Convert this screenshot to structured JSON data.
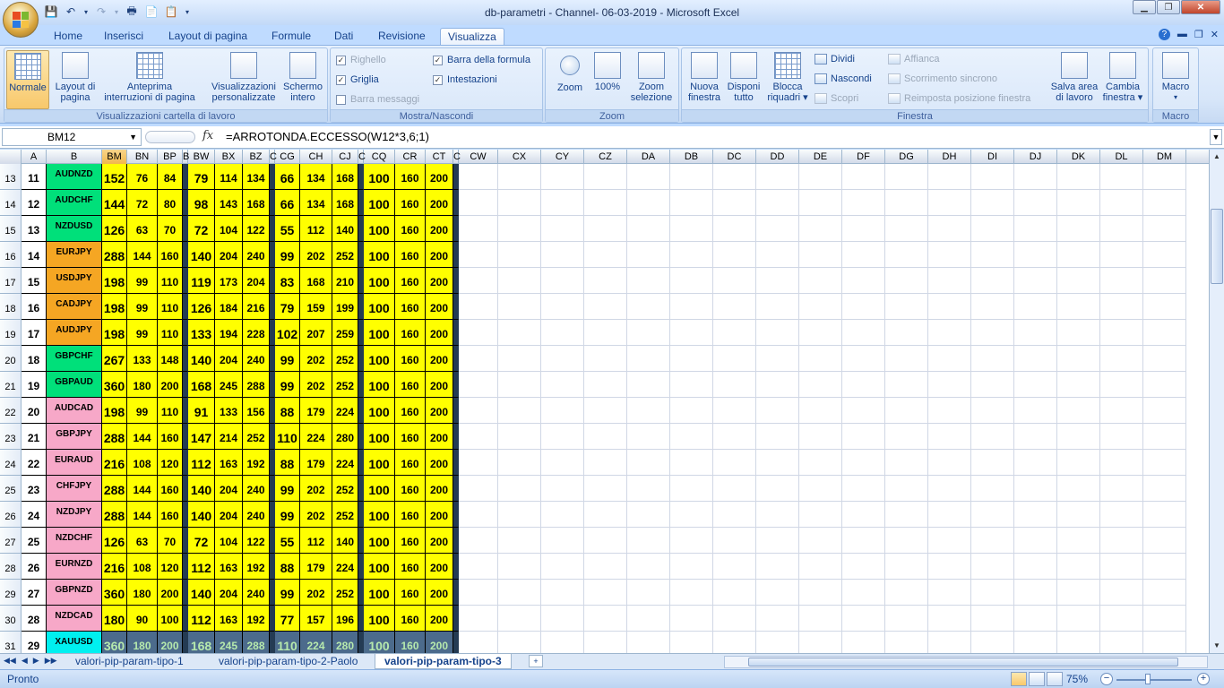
{
  "window": {
    "title": "db-parametri - Channel- 06-03-2019 - Microsoft Excel",
    "controls": {
      "minimize": "▁",
      "restore": "❐",
      "close": "✕"
    }
  },
  "qat_icons": [
    "save-icon",
    "undo-icon",
    "undo-dropdown-icon",
    "redo-icon",
    "redo-dropdown-icon",
    "print-preview-icon",
    "new-document-icon",
    "paste-icon",
    "customize-dropdown-icon"
  ],
  "ribbon": {
    "tabs": [
      "Home",
      "Inserisci",
      "Layout di pagina",
      "Formule",
      "Dati",
      "Revisione",
      "Visualizza"
    ],
    "active_tab": "Visualizza",
    "right_icons": [
      "help-icon",
      "minimize-ribbon-icon",
      "restore-workbook-icon",
      "close-workbook-icon"
    ],
    "groups": {
      "views": {
        "label": "Visualizzazioni cartella di lavoro",
        "normale": "Normale",
        "layout_line1": "Layout di",
        "layout_line2": "pagina",
        "anteprima_line1": "Anteprima",
        "anteprima_line2": "interruzioni di pagina",
        "personal_line1": "Visualizzazioni",
        "personal_line2": "personalizzate",
        "schermo_line1": "Schermo",
        "schermo_line2": "intero"
      },
      "showhide": {
        "label": "Mostra/Nascondi",
        "righello": "Righello",
        "griglia": "Griglia",
        "barra_messaggi": "Barra messaggi",
        "barra_formula": "Barra della formula",
        "intestazioni": "Intestazioni"
      },
      "zoom": {
        "label": "Zoom",
        "zoom": "Zoom",
        "z100": "100%",
        "sel_line1": "Zoom",
        "sel_line2": "selezione"
      },
      "finestra": {
        "label": "Finestra",
        "nuova_line1": "Nuova",
        "nuova_line2": "finestra",
        "disponi_line1": "Disponi",
        "disponi_line2": "tutto",
        "blocca_line1": "Blocca",
        "blocca_line2": "riquadri ▾",
        "dividi": "Dividi",
        "nascondi": "Nascondi",
        "scopri": "Scopri",
        "affianca": "Affianca",
        "scorrimento": "Scorrimento sincrono",
        "reimposta": "Reimposta posizione finestra",
        "salva_line1": "Salva area",
        "salva_line2": "di lavoro",
        "cambia_line1": "Cambia",
        "cambia_line2": "finestra ▾"
      },
      "macro": {
        "label": "Macro",
        "macro": "Macro",
        "macro_dd": "▾"
      }
    }
  },
  "formula_bar": {
    "name_box": "BM12",
    "fx": "fx",
    "formula": "=ARROTONDA.ECCESSO(W12*3,6;1)"
  },
  "columns": [
    "A",
    "B",
    "BM",
    "BN",
    "BP",
    "B",
    "BW",
    "BX",
    "BZ",
    "C",
    "CG",
    "CH",
    "CJ",
    "C",
    "CQ",
    "CR",
    "CT",
    "C",
    "CW",
    "CX",
    "CY",
    "CZ",
    "DA",
    "DB",
    "DC",
    "DD",
    "DE",
    "DF",
    "DG",
    "DH",
    "DI",
    "DJ",
    "DK",
    "DL",
    "DM"
  ],
  "selected_column": "BM",
  "rows": [
    {
      "row": "13",
      "a": "11",
      "sym": "AUDNZD",
      "color": "#00e07a",
      "v": [
        "152",
        "76",
        "84",
        "79",
        "114",
        "134",
        "66",
        "134",
        "168",
        "100",
        "160",
        "200"
      ]
    },
    {
      "row": "14",
      "a": "12",
      "sym": "AUDCHF",
      "color": "#00e07a",
      "v": [
        "144",
        "72",
        "80",
        "98",
        "143",
        "168",
        "66",
        "134",
        "168",
        "100",
        "160",
        "200"
      ]
    },
    {
      "row": "15",
      "a": "13",
      "sym": "NZDUSD",
      "color": "#00e07a",
      "v": [
        "126",
        "63",
        "70",
        "72",
        "104",
        "122",
        "55",
        "112",
        "140",
        "100",
        "160",
        "200"
      ]
    },
    {
      "row": "16",
      "a": "14",
      "sym": "EURJPY",
      "color": "#f5a623",
      "v": [
        "288",
        "144",
        "160",
        "140",
        "204",
        "240",
        "99",
        "202",
        "252",
        "100",
        "160",
        "200"
      ]
    },
    {
      "row": "17",
      "a": "15",
      "sym": "USDJPY",
      "color": "#f5a623",
      "v": [
        "198",
        "99",
        "110",
        "119",
        "173",
        "204",
        "83",
        "168",
        "210",
        "100",
        "160",
        "200"
      ]
    },
    {
      "row": "18",
      "a": "16",
      "sym": "CADJPY",
      "color": "#f5a623",
      "v": [
        "198",
        "99",
        "110",
        "126",
        "184",
        "216",
        "79",
        "159",
        "199",
        "100",
        "160",
        "200"
      ]
    },
    {
      "row": "19",
      "a": "17",
      "sym": "AUDJPY",
      "color": "#f5a623",
      "v": [
        "198",
        "99",
        "110",
        "133",
        "194",
        "228",
        "102",
        "207",
        "259",
        "100",
        "160",
        "200"
      ]
    },
    {
      "row": "20",
      "a": "18",
      "sym": "GBPCHF",
      "color": "#00e07a",
      "v": [
        "267",
        "133",
        "148",
        "140",
        "204",
        "240",
        "99",
        "202",
        "252",
        "100",
        "160",
        "200"
      ]
    },
    {
      "row": "21",
      "a": "19",
      "sym": "GBPAUD",
      "color": "#00e07a",
      "v": [
        "360",
        "180",
        "200",
        "168",
        "245",
        "288",
        "99",
        "202",
        "252",
        "100",
        "160",
        "200"
      ]
    },
    {
      "row": "22",
      "a": "20",
      "sym": "AUDCAD",
      "color": "#f7a8c8",
      "v": [
        "198",
        "99",
        "110",
        "91",
        "133",
        "156",
        "88",
        "179",
        "224",
        "100",
        "160",
        "200"
      ]
    },
    {
      "row": "23",
      "a": "21",
      "sym": "GBPJPY",
      "color": "#f7a8c8",
      "v": [
        "288",
        "144",
        "160",
        "147",
        "214",
        "252",
        "110",
        "224",
        "280",
        "100",
        "160",
        "200"
      ]
    },
    {
      "row": "24",
      "a": "22",
      "sym": "EURAUD",
      "color": "#f7a8c8",
      "v": [
        "216",
        "108",
        "120",
        "112",
        "163",
        "192",
        "88",
        "179",
        "224",
        "100",
        "160",
        "200"
      ]
    },
    {
      "row": "25",
      "a": "23",
      "sym": "CHFJPY",
      "color": "#f7a8c8",
      "v": [
        "288",
        "144",
        "160",
        "140",
        "204",
        "240",
        "99",
        "202",
        "252",
        "100",
        "160",
        "200"
      ]
    },
    {
      "row": "26",
      "a": "24",
      "sym": "NZDJPY",
      "color": "#f7a8c8",
      "v": [
        "288",
        "144",
        "160",
        "140",
        "204",
        "240",
        "99",
        "202",
        "252",
        "100",
        "160",
        "200"
      ]
    },
    {
      "row": "27",
      "a": "25",
      "sym": "NZDCHF",
      "color": "#f7a8c8",
      "v": [
        "126",
        "63",
        "70",
        "72",
        "104",
        "122",
        "55",
        "112",
        "140",
        "100",
        "160",
        "200"
      ]
    },
    {
      "row": "28",
      "a": "26",
      "sym": "EURNZD",
      "color": "#f7a8c8",
      "v": [
        "216",
        "108",
        "120",
        "112",
        "163",
        "192",
        "88",
        "179",
        "224",
        "100",
        "160",
        "200"
      ]
    },
    {
      "row": "29",
      "a": "27",
      "sym": "GBPNZD",
      "color": "#f7a8c8",
      "v": [
        "360",
        "180",
        "200",
        "140",
        "204",
        "240",
        "99",
        "202",
        "252",
        "100",
        "160",
        "200"
      ]
    },
    {
      "row": "30",
      "a": "28",
      "sym": "NZDCAD",
      "color": "#f7a8c8",
      "v": [
        "180",
        "90",
        "100",
        "112",
        "163",
        "192",
        "77",
        "157",
        "196",
        "100",
        "160",
        "200"
      ]
    },
    {
      "row": "31",
      "a": "29",
      "sym": "XAUUSD",
      "color": "#00f0f0",
      "v": [
        "360",
        "180",
        "200",
        "168",
        "245",
        "288",
        "110",
        "224",
        "280",
        "100",
        "160",
        "200"
      ],
      "dark": true
    }
  ],
  "sheet_tabs": [
    "valori-pip-param-tipo-1",
    "valori-pip-param-tipo-2-Paolo",
    "valori-pip-param-tipo-3"
  ],
  "active_sheet": "valori-pip-param-tipo-3",
  "status": {
    "text": "Pronto",
    "zoom": "75%"
  }
}
